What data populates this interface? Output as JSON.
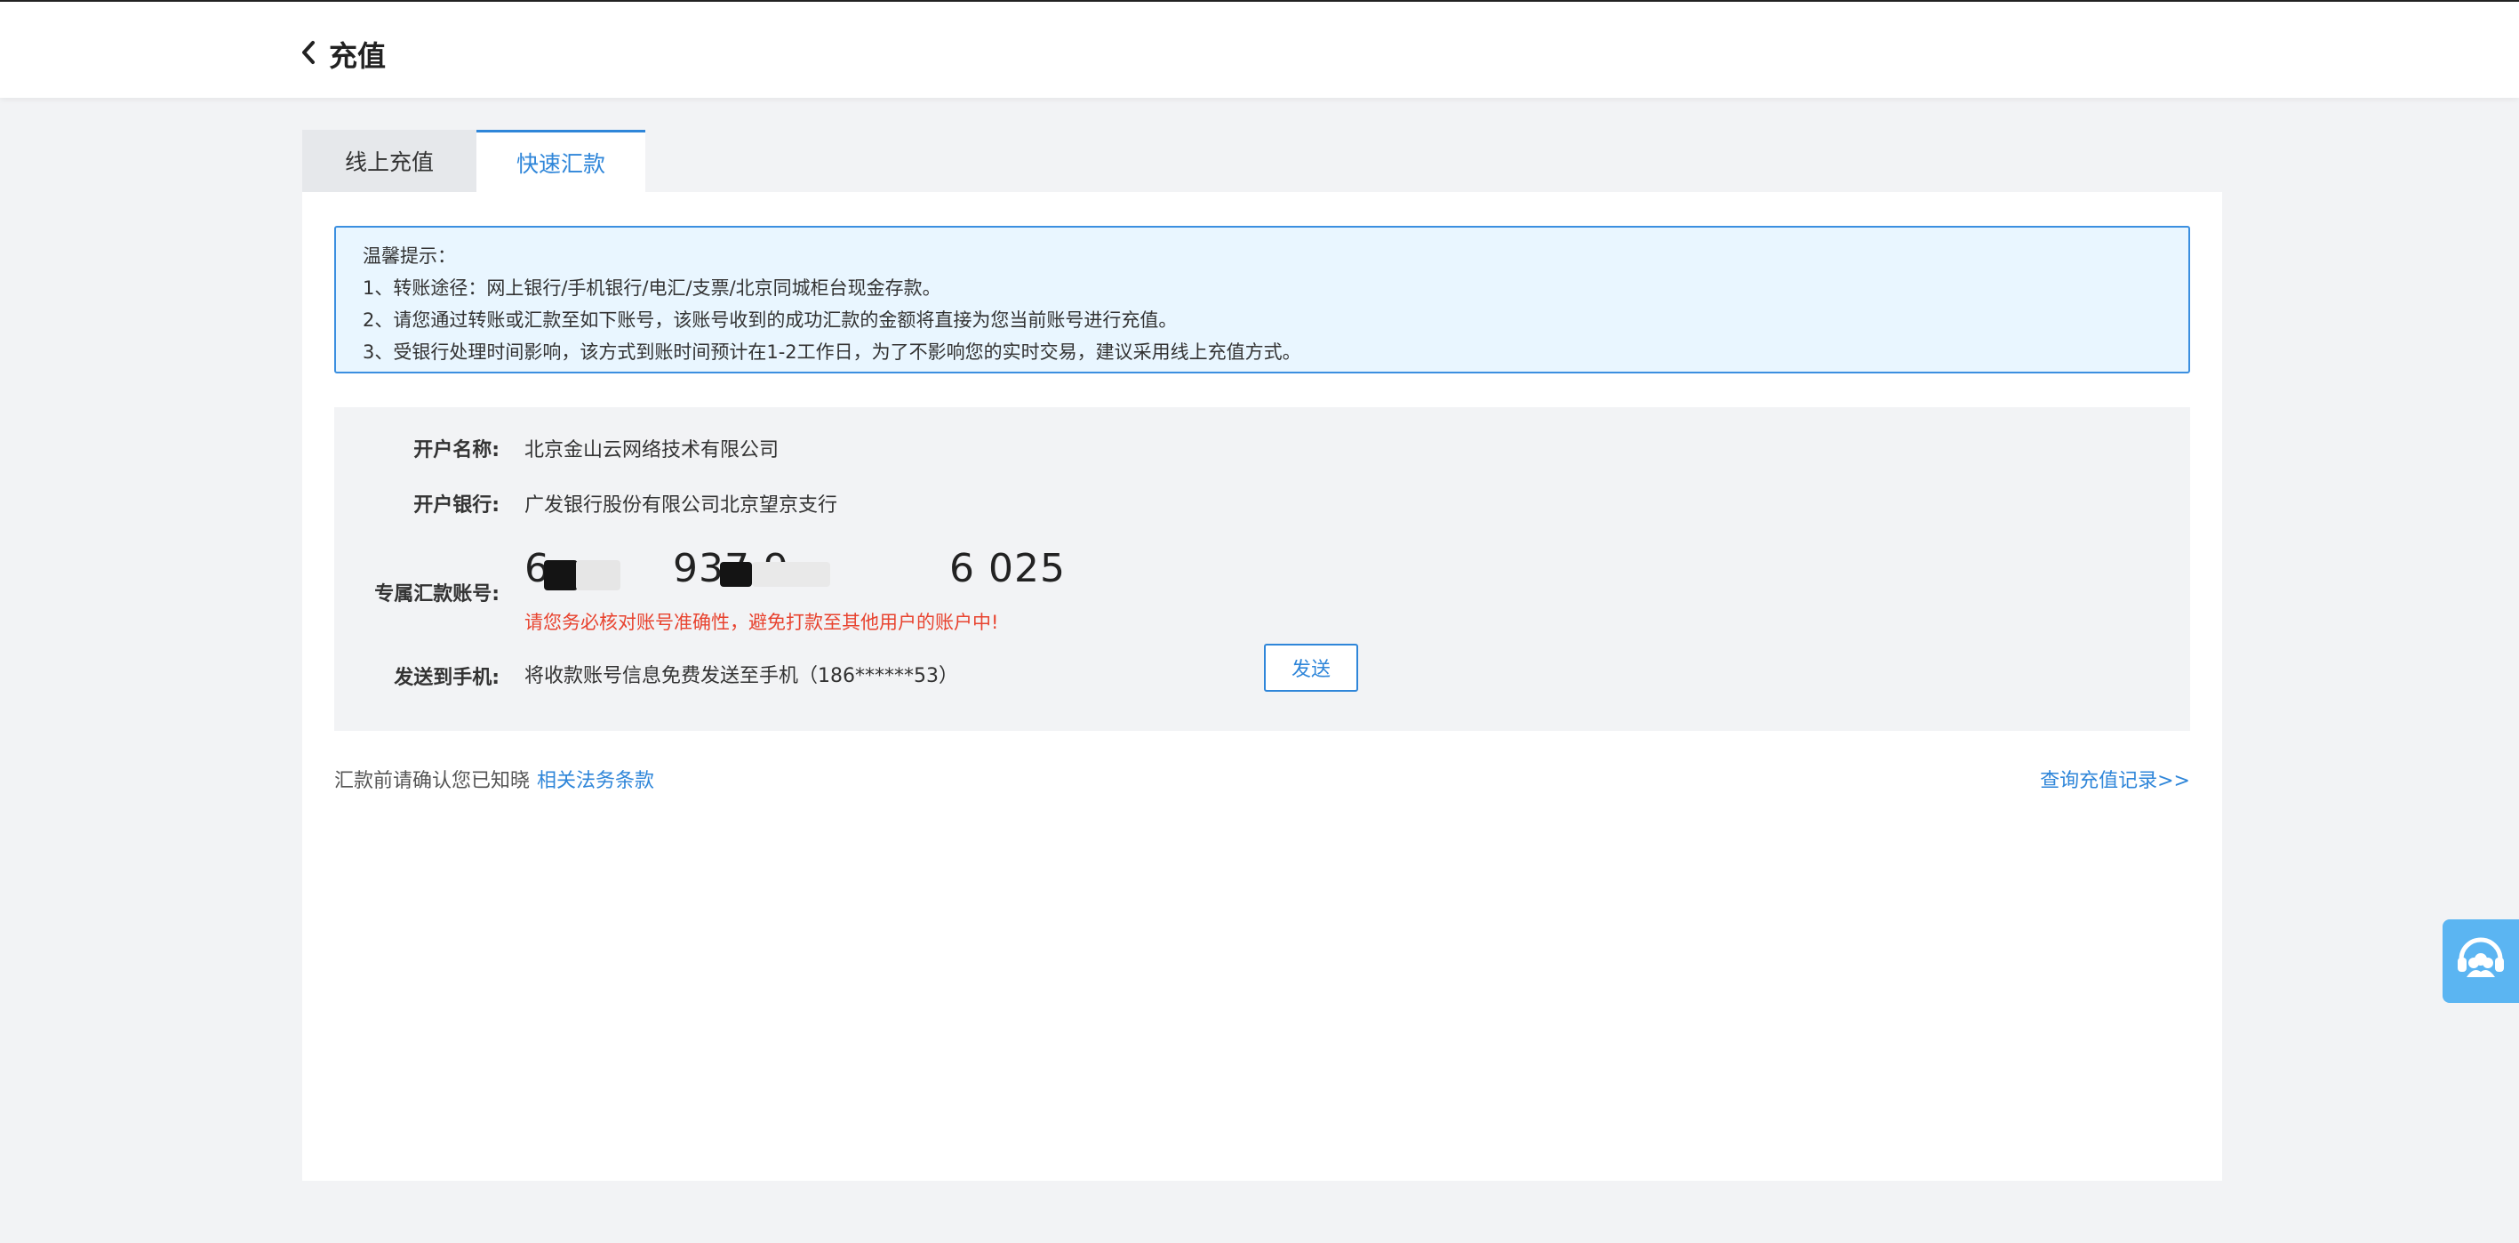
{
  "header": {
    "title": "充值",
    "back_icon": "chevron-left-icon"
  },
  "tabs": [
    {
      "label": "线上充值",
      "active": false
    },
    {
      "label": "快速汇款",
      "active": true
    }
  ],
  "notice": {
    "title": "温馨提示：",
    "lines": [
      "1、转账途径：网上银行/手机银行/电汇/支票/北京同城柜台现金存款。",
      "2、请您通过转账或汇款至如下账号，该账号收到的成功汇款的金额将直接为您当前账号进行充值。",
      "3、受银行处理时间影响，该方式到账时间预计在1-2工作日，为了不影响您的实时交易，建议采用线上充值方式。"
    ]
  },
  "info": {
    "account_name_label": "开户名称:",
    "account_name": "北京金山云网络技术有限公司",
    "bank_label": "开户银行:",
    "bank": "广发银行股份有限公司北京望京支行",
    "account_no_label": "专属汇款账号:",
    "account_no_parts": [
      "6",
      "937 9",
      "6 025"
    ],
    "warning": "请您务必核对账号准确性，避免打款至其他用户的账户中!",
    "phone_label": "发送到手机:",
    "phone_text": "将收款账号信息免费发送至手机（186******53）",
    "send_button": "发送"
  },
  "footer": {
    "confirm_text": "汇款前请确认您已知晓",
    "terms_link": "相关法务条款",
    "records_link": "查询充值记录>>"
  },
  "colors": {
    "accent": "#2f86d9",
    "warning": "#e8432f",
    "notice_bg": "#e9f6ff"
  }
}
